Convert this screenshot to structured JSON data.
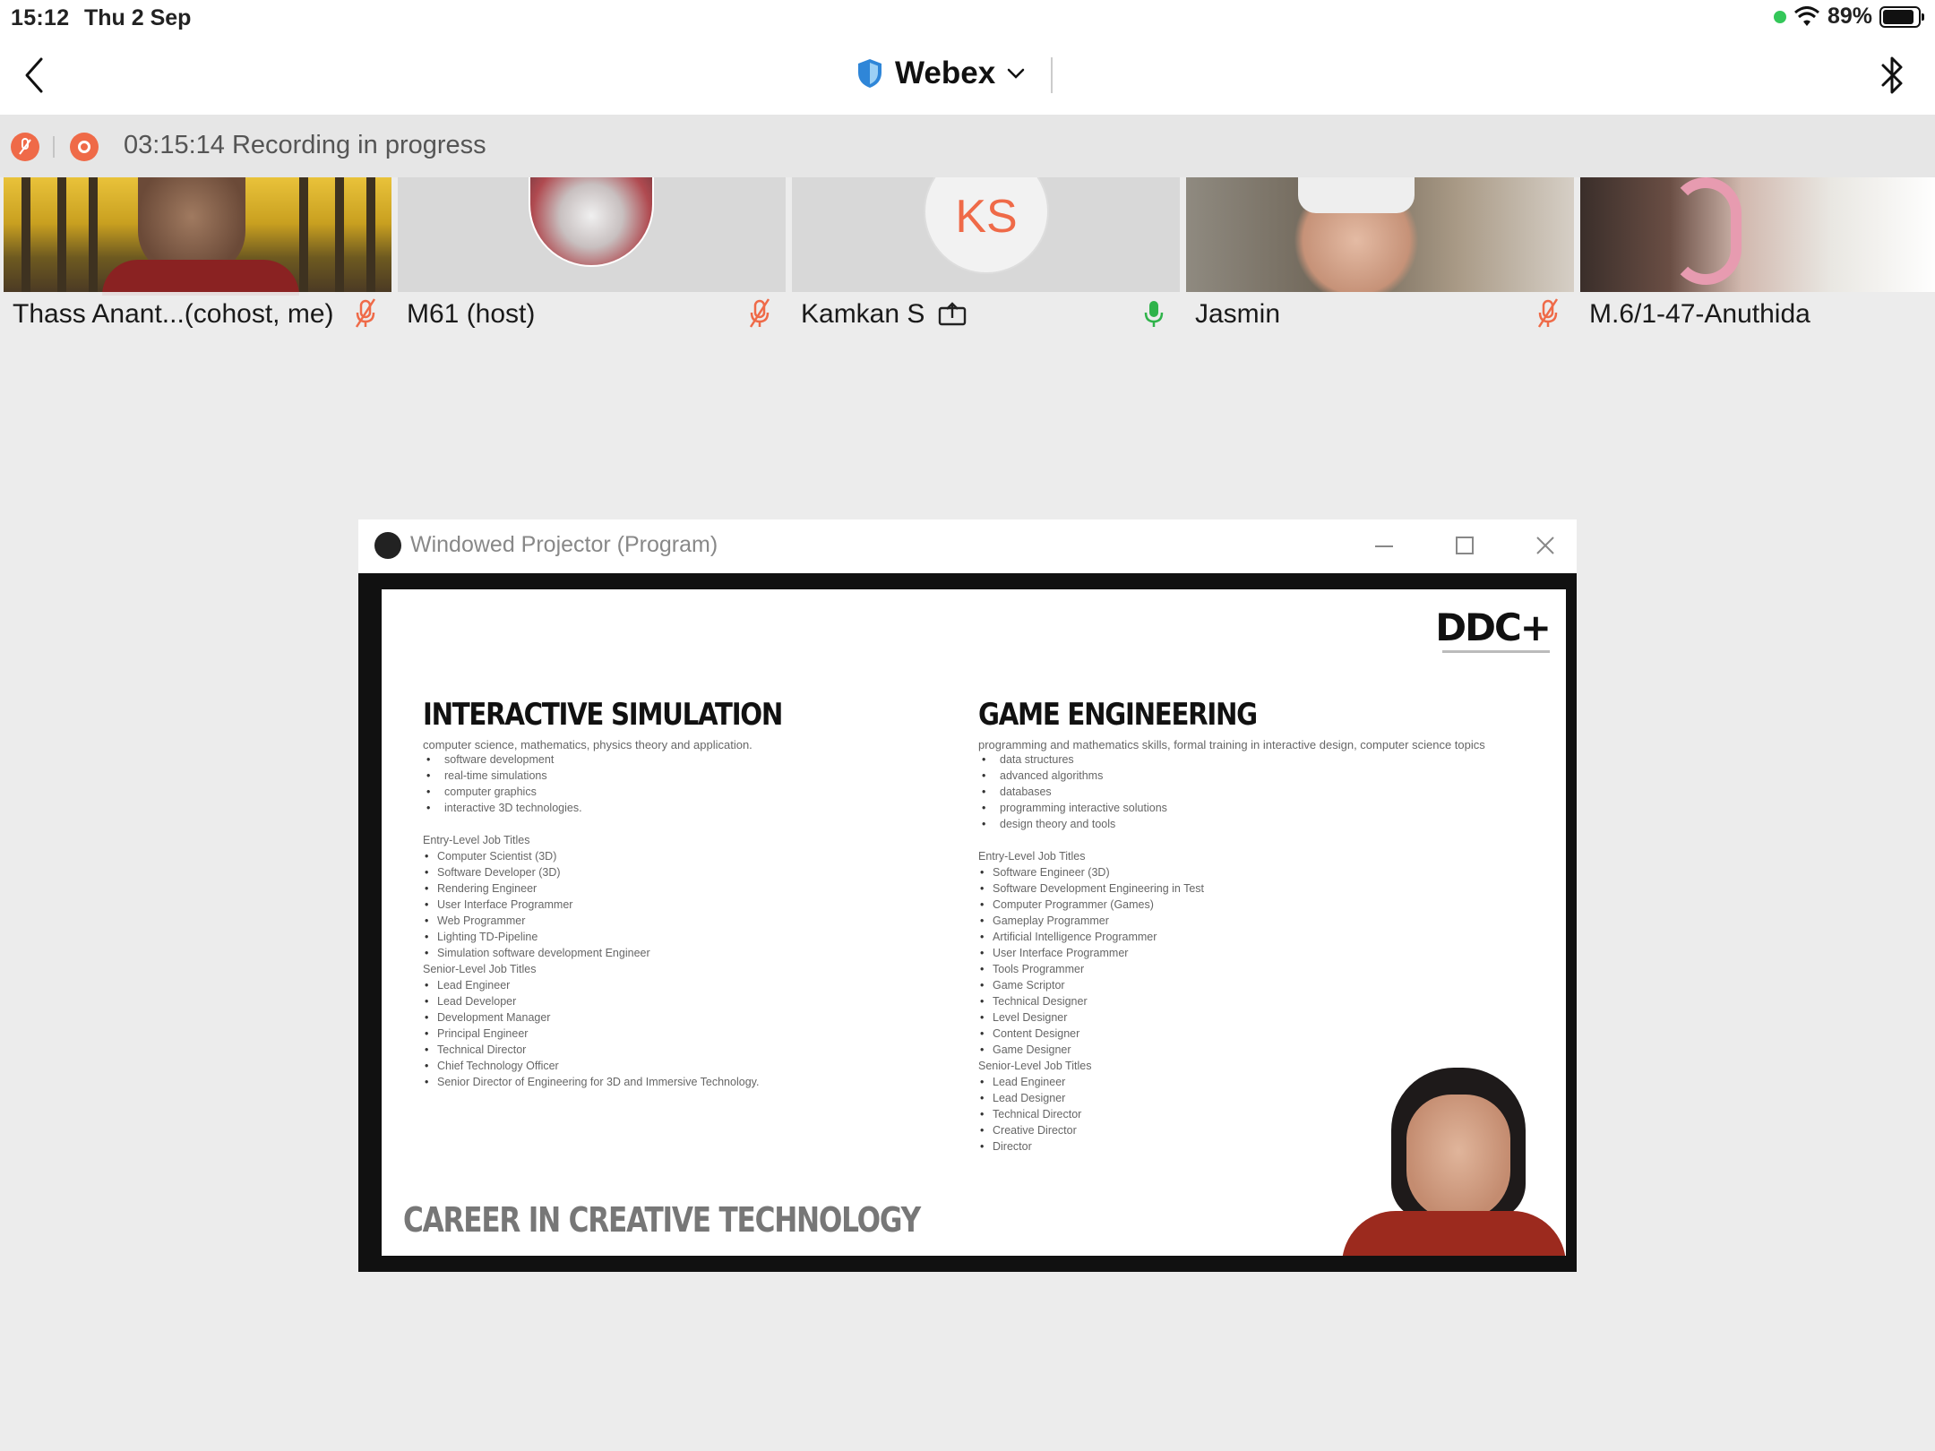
{
  "status_bar": {
    "time": "15:12",
    "date": "Thu 2 Sep",
    "battery_percent": "89%",
    "battery_level": 0.89
  },
  "nav": {
    "app_title": "Webex"
  },
  "recording": {
    "text": "03:15:14 Recording in progress"
  },
  "participants": [
    {
      "name": "Thass Anant...(cohost, me)",
      "mic": "muted"
    },
    {
      "name": "M61 (host)",
      "mic": "muted"
    },
    {
      "name": "Kamkan S",
      "mic": "active",
      "sharing": true,
      "initials": "KS"
    },
    {
      "name": "Jasmin",
      "mic": "muted"
    },
    {
      "name": "M.6/1-47-Anuthida",
      "mic": "muted"
    }
  ],
  "projector": {
    "window_title": "Windowed Projector (Program)",
    "slide": {
      "logo": "DDC+",
      "footer": "CAREER IN CREATIVE TECHNOLOGY",
      "left": {
        "title": "INTERACTIVE SIMULATION",
        "intro": "computer science, mathematics, physics theory and application.",
        "topics": [
          "software development",
          "real-time simulations",
          "computer graphics",
          "interactive 3D technologies."
        ],
        "entry_heading": "Entry-Level Job Titles",
        "entry_jobs": [
          "Computer Scientist (3D)",
          "Software Developer (3D)",
          "Rendering Engineer",
          "User Interface Programmer",
          "Web Programmer",
          "Lighting TD-Pipeline",
          "Simulation software development Engineer"
        ],
        "senior_heading": "Senior-Level Job Titles",
        "senior_jobs": [
          "Lead Engineer",
          "Lead Developer",
          "Development Manager",
          "Principal Engineer",
          "Technical Director",
          "Chief Technology Officer",
          "Senior Director of Engineering for 3D and Immersive Technology."
        ]
      },
      "right": {
        "title": "GAME ENGINEERING",
        "intro": "programming and mathematics skills, formal training in interactive design, computer science topics",
        "topics": [
          "data structures",
          "advanced algorithms",
          "databases",
          "programming interactive solutions",
          "design theory and tools"
        ],
        "entry_heading": "Entry-Level Job Titles",
        "entry_jobs": [
          "Software Engineer (3D)",
          "Software Development Engineering in Test",
          "Computer Programmer (Games)",
          "Gameplay Programmer",
          "Artificial Intelligence Programmer",
          "User Interface Programmer",
          "Tools Programmer",
          "Game Scriptor",
          "Technical Designer",
          "Level Designer",
          "Content Designer",
          "Game Designer"
        ],
        "senior_heading": "Senior-Level Job Titles",
        "senior_jobs": [
          "Lead Engineer",
          "Lead Designer",
          "Technical Director",
          "Creative Director",
          "Director"
        ]
      }
    }
  },
  "colors": {
    "accent_orange": "#ef6a48",
    "mic_active_green": "#2fb34a",
    "background": "#ececec"
  }
}
